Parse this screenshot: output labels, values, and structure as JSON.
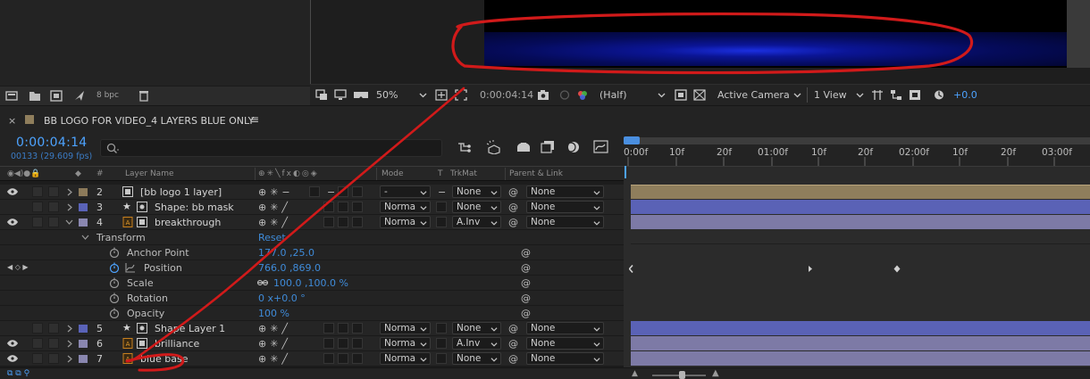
{
  "project_bar": {
    "bpc": "8 bpc"
  },
  "viewer_bar": {
    "zoom": "50%",
    "timecode": "0:00:04:14",
    "resolution": "(Half)",
    "camera": "Active Camera",
    "views": "1 View",
    "exposure": "+0.0"
  },
  "timeline": {
    "tab_title": "BB LOGO FOR VIDEO_4 LAYERS BLUE ONLY",
    "current_time": "0:00:04:14",
    "frame_info": "00133 (29.609 fps)",
    "ruler_labels": [
      "0:00f",
      "10f",
      "20f",
      "01:00f",
      "10f",
      "20f",
      "02:00f",
      "10f",
      "20f",
      "03:00f"
    ]
  },
  "columns": {
    "hash": "#",
    "layer_name": "Layer Name",
    "mode": "Mode",
    "t": "T",
    "trkmat": "TrkMat",
    "parent": "Parent & Link"
  },
  "layers": [
    {
      "num": "2",
      "name": "[bb logo 1 layer]",
      "mode": "-",
      "trkmat": "None",
      "parent": "None",
      "label": "#8c7a5a"
    },
    {
      "num": "3",
      "name": "Shape: bb mask",
      "mode": "Norma",
      "trkmat": "None",
      "parent": "None",
      "label": "#5a63b8"
    },
    {
      "num": "4",
      "name": "breakthrough",
      "mode": "Norma",
      "trkmat": "A.Inv",
      "parent": "None",
      "label": "#8a87b0"
    },
    {
      "num": "5",
      "name": "Shape Layer 1",
      "mode": "Norma",
      "trkmat": "None",
      "parent": "None",
      "label": "#5a63b8"
    },
    {
      "num": "6",
      "name": "brilliance",
      "mode": "Norma",
      "trkmat": "A.Inv",
      "parent": "None",
      "label": "#8a87b0"
    },
    {
      "num": "7",
      "name": "blue base",
      "mode": "Norma",
      "trkmat": "None",
      "parent": "None",
      "label": "#8a87b0"
    }
  ],
  "transform": {
    "group": "Transform",
    "reset": "Reset",
    "properties": [
      {
        "name": "Anchor Point",
        "value": "177.0 ,25.0"
      },
      {
        "name": "Position",
        "value": "766.0 ,869.0"
      },
      {
        "name": "Scale",
        "value": "100.0 ,100.0 %"
      },
      {
        "name": "Rotation",
        "value": "0 x+0.0 °"
      },
      {
        "name": "Opacity",
        "value": "100 %"
      }
    ]
  },
  "colors": {
    "accent_blue": "#4da3ff",
    "annotation_red": "#d11a1a",
    "track_tan": "#8f7e5c",
    "track_blue": "#5a62b6",
    "track_lavender": "#7d7aa6"
  }
}
